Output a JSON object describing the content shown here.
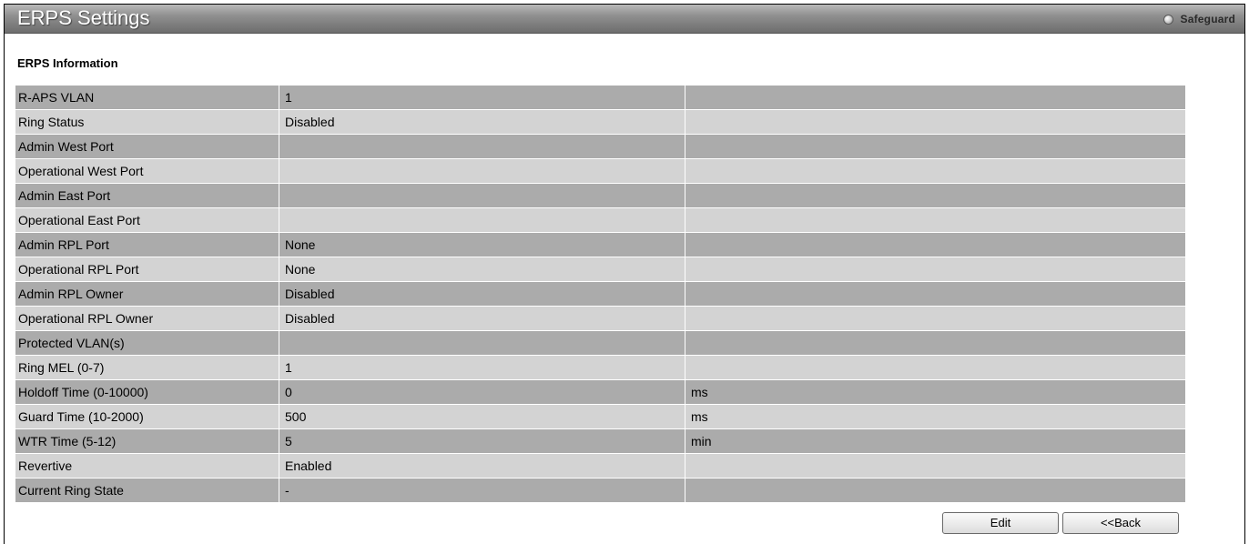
{
  "window": {
    "title": "ERPS Settings",
    "safeguard_label": "Safeguard"
  },
  "section": {
    "title": "ERPS Information"
  },
  "rows": [
    {
      "label": "R-APS VLAN",
      "value": "1",
      "unit": ""
    },
    {
      "label": "Ring Status",
      "value": "Disabled",
      "unit": ""
    },
    {
      "label": "Admin West Port",
      "value": "",
      "unit": ""
    },
    {
      "label": "Operational West Port",
      "value": "",
      "unit": ""
    },
    {
      "label": "Admin East Port",
      "value": "",
      "unit": ""
    },
    {
      "label": "Operational East Port",
      "value": "",
      "unit": ""
    },
    {
      "label": "Admin RPL Port",
      "value": "None",
      "unit": ""
    },
    {
      "label": "Operational RPL Port",
      "value": "None",
      "unit": ""
    },
    {
      "label": "Admin RPL Owner",
      "value": "Disabled",
      "unit": ""
    },
    {
      "label": "Operational RPL Owner",
      "value": "Disabled",
      "unit": ""
    },
    {
      "label": "Protected VLAN(s)",
      "value": "",
      "unit": ""
    },
    {
      "label": "Ring MEL (0-7)",
      "value": "1",
      "unit": ""
    },
    {
      "label": "Holdoff Time (0-10000)",
      "value": "0",
      "unit": "ms"
    },
    {
      "label": "Guard Time (10-2000)",
      "value": "500",
      "unit": "ms"
    },
    {
      "label": "WTR Time (5-12)",
      "value": "5",
      "unit": "min"
    },
    {
      "label": "Revertive",
      "value": "Enabled",
      "unit": ""
    },
    {
      "label": "Current Ring State",
      "value": "-",
      "unit": ""
    }
  ],
  "buttons": {
    "edit_label": "Edit",
    "back_label": "<<Back"
  },
  "icons": {
    "safeguard": "status-dot-icon"
  },
  "colors": {
    "title_bar": "#7a7a7a",
    "row_dark": "#ababab",
    "row_light": "#d3d3d3"
  }
}
